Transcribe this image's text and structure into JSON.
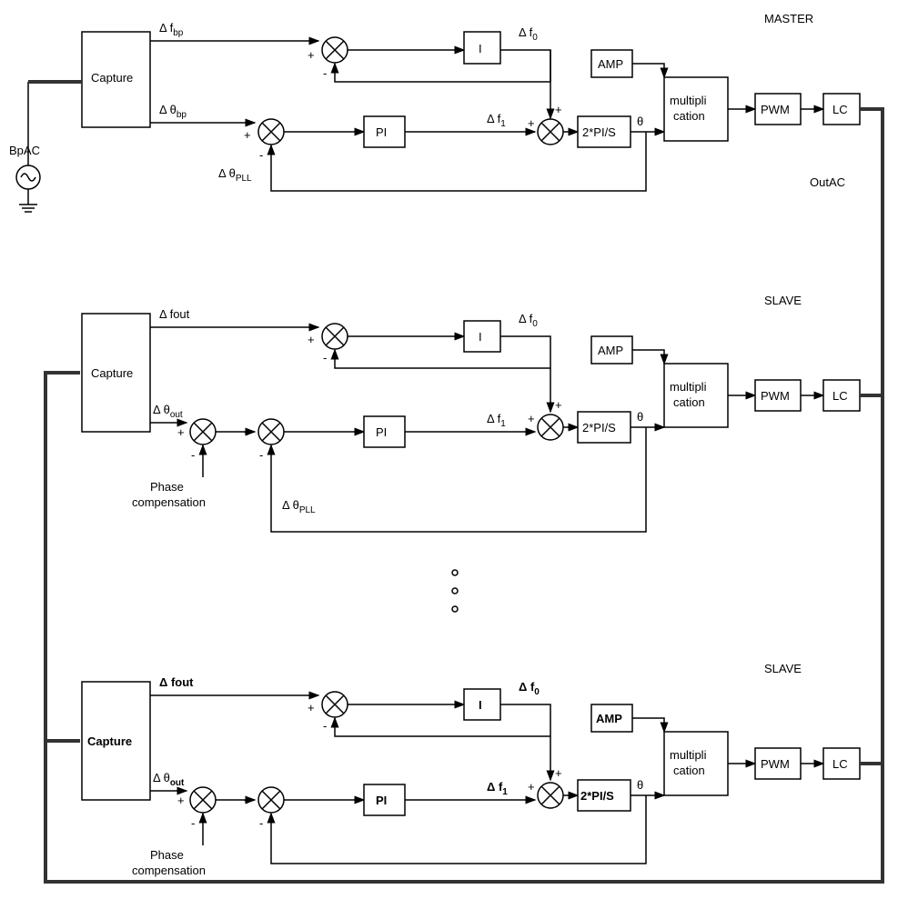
{
  "master": {
    "title": "MASTER",
    "capture": "Capture",
    "df_bp": "Δ f",
    "df_bp_sub": "bp",
    "dth_bp": "Δ θ",
    "dth_bp_sub": "bp",
    "dth_pll": "Δ θ",
    "dth_pll_sub": "PLL",
    "I": "I",
    "PI": "PI",
    "df0": "Δ f",
    "df0_sub": "0",
    "df1": "Δ f",
    "df1_sub": "1",
    "amp": "AMP",
    "mult": "multipli",
    "mult2": "cation",
    "pwm": "PWM",
    "lc": "LC",
    "twopis": "2*PI/S",
    "theta": "θ",
    "plus": "+",
    "minus": "-",
    "bpac": "BpAC",
    "outac": "OutAC"
  },
  "slave1": {
    "title": "SLAVE",
    "capture": "Capture",
    "dfout": "Δ fout",
    "dthout": "Δ θ",
    "dthout_sub": "out",
    "dth_pll": "Δ θ",
    "dth_pll_sub": "PLL",
    "I": "I",
    "PI": "PI",
    "df0": "Δ f",
    "df0_sub": "0",
    "df1": "Δ f",
    "df1_sub": "1",
    "amp": "AMP",
    "mult": "multipli",
    "mult2": "cation",
    "pwm": "PWM",
    "lc": "LC",
    "twopis": "2*PI/S",
    "theta": "θ",
    "phase": "Phase",
    "compensation": "compensation",
    "plus": "+",
    "minus": "-"
  },
  "slave2": {
    "title": "SLAVE",
    "capture": "Capture",
    "dfout": "Δ fout",
    "dthout": "Δ θ",
    "dthout_sub": "out",
    "I": "I",
    "PI": "PI",
    "df0": "Δ f",
    "df0_sub": "0",
    "df1": "Δ f",
    "df1_sub": "1",
    "amp": "AMP",
    "mult": "multipli",
    "mult2": "cation",
    "pwm": "PWM",
    "lc": "LC",
    "twopis": "2*PI/S",
    "theta": "θ",
    "phase": "Phase",
    "compensation": "compensation",
    "plus": "+",
    "minus": "-"
  }
}
